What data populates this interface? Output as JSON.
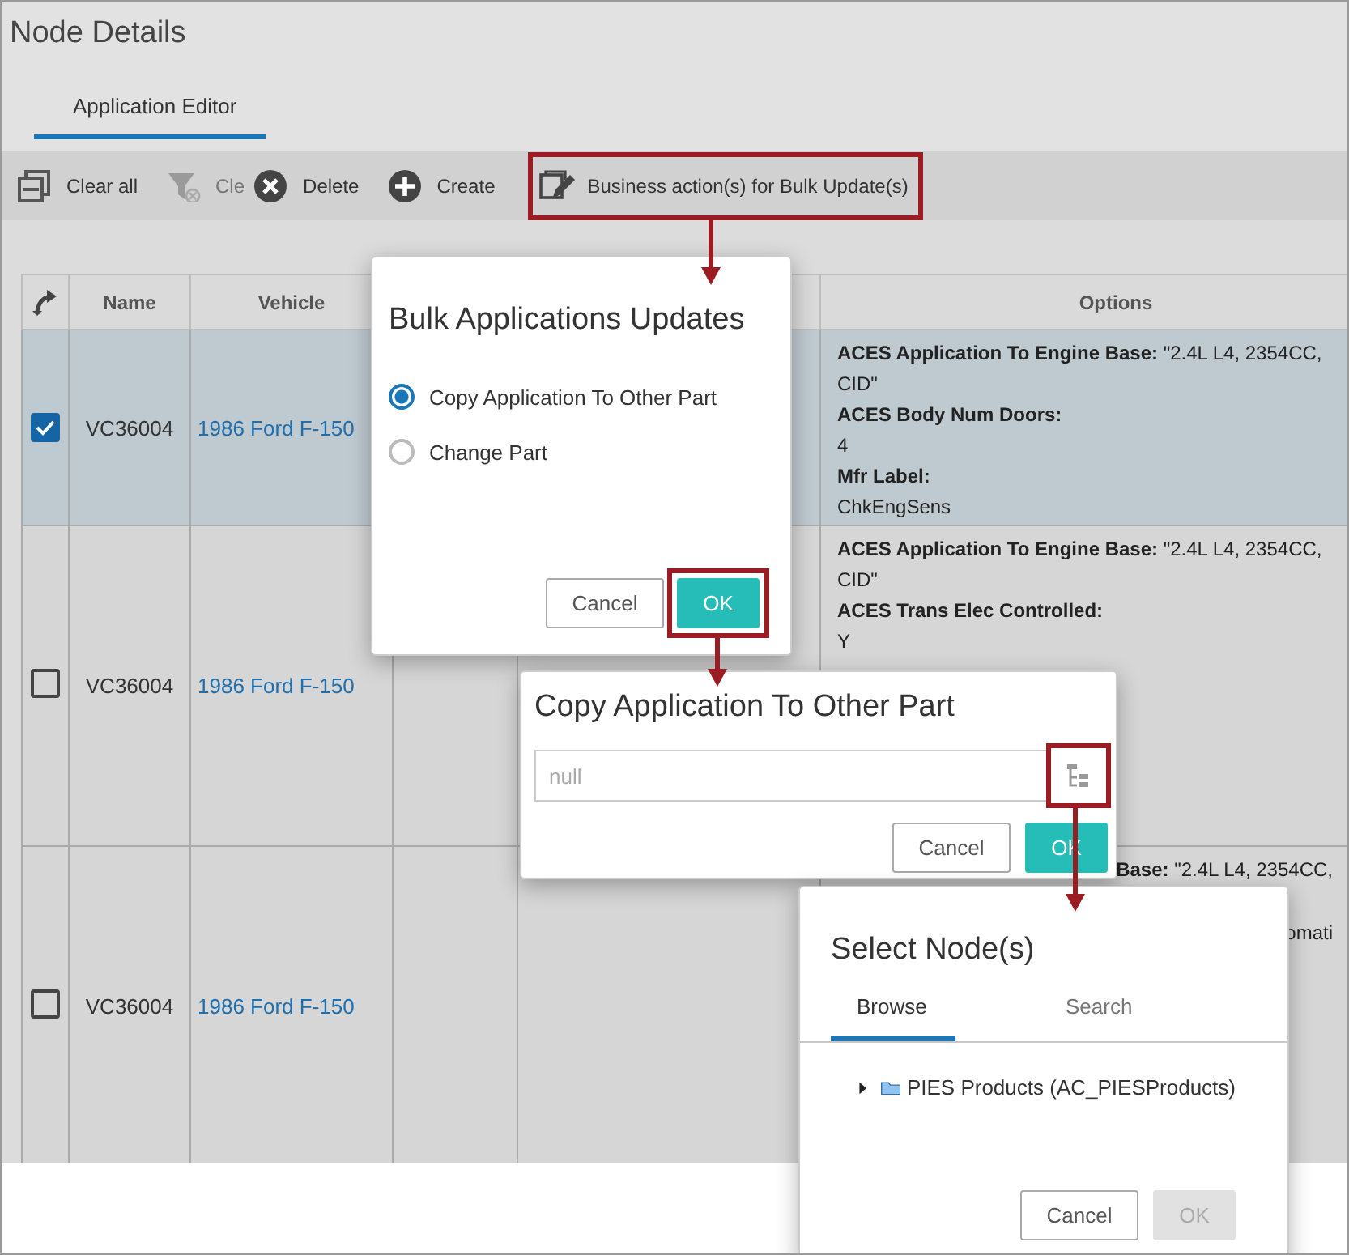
{
  "page": {
    "title": "Node Details"
  },
  "tabs": [
    {
      "label": "Application Editor",
      "selected": true
    }
  ],
  "toolbar": [
    {
      "kind": "clear-all",
      "label": "Clear all",
      "disabled": false,
      "highlighted": false
    },
    {
      "kind": "filter-clear",
      "label": "Cle",
      "disabled": true,
      "highlighted": false
    },
    {
      "kind": "delete",
      "label": "Delete",
      "disabled": false,
      "highlighted": false
    },
    {
      "kind": "create",
      "label": "Create",
      "disabled": false,
      "highlighted": false
    },
    {
      "kind": "bulk-edit",
      "label": "Business action(s) for Bulk Update(s)",
      "disabled": false,
      "highlighted": true
    }
  ],
  "table": {
    "columns": [
      "Name",
      "Vehicle",
      "Options"
    ],
    "rows": [
      {
        "checked": true,
        "selected": true,
        "name": "VC36004",
        "vehicle": "1986 Ford F-150",
        "options": [
          {
            "kind": "inline",
            "label": "ACES Application To Engine Base:",
            "value": "\"2.4L L4, 2354CC, CID\""
          },
          {
            "kind": "stacked",
            "label": "ACES Body Num Doors:",
            "value": "4"
          },
          {
            "kind": "stacked",
            "label": "Mfr Label:",
            "value": "ChkEngSens"
          }
        ]
      },
      {
        "checked": false,
        "selected": false,
        "name": "VC36004",
        "vehicle": "1986 Ford F-150",
        "options": [
          {
            "kind": "inline",
            "label": "ACES Application To Engine Base:",
            "value": "\"2.4L L4, 2354CC, CID\""
          },
          {
            "kind": "stacked",
            "label": "ACES Trans Elec Controlled:",
            "value": "Y"
          }
        ]
      },
      {
        "checked": false,
        "selected": false,
        "name": "VC36004",
        "vehicle": "1986 Ford F-150",
        "options": [
          {
            "kind": "fragment",
            "label": "Base:",
            "value": "\"2.4L L4, 2354CC,"
          },
          {
            "kind": "fragment",
            "value": "omati"
          }
        ]
      }
    ]
  },
  "bulk_dialog": {
    "title": "Bulk Applications Updates",
    "options": [
      {
        "label": "Copy Application To Other Part",
        "selected": true
      },
      {
        "label": "Change Part",
        "selected": false
      }
    ],
    "buttons": [
      {
        "kind": "secondary",
        "label": "Cancel",
        "disabled": false,
        "highlighted": false
      },
      {
        "kind": "primary",
        "label": "OK",
        "disabled": false,
        "highlighted": true
      }
    ]
  },
  "copy_dialog": {
    "title": "Copy Application To Other Part",
    "field": {
      "placeholder": "null",
      "browse_highlighted": true
    },
    "buttons": [
      {
        "kind": "secondary",
        "label": "Cancel",
        "disabled": false,
        "highlighted": false
      },
      {
        "kind": "primary",
        "label": "OK",
        "disabled": false,
        "highlighted": false
      }
    ]
  },
  "select_dialog": {
    "title": "Select Node(s)",
    "tabs": [
      {
        "label": "Browse",
        "selected": true
      },
      {
        "label": "Search",
        "selected": false
      }
    ],
    "tree": [
      {
        "label": "PIES Products (AC_PIESProducts)",
        "expanded": false
      }
    ],
    "buttons": [
      {
        "kind": "secondary",
        "label": "Cancel",
        "disabled": false,
        "highlighted": false
      },
      {
        "kind": "primary",
        "label": "OK",
        "disabled": true,
        "highlighted": false
      }
    ]
  }
}
